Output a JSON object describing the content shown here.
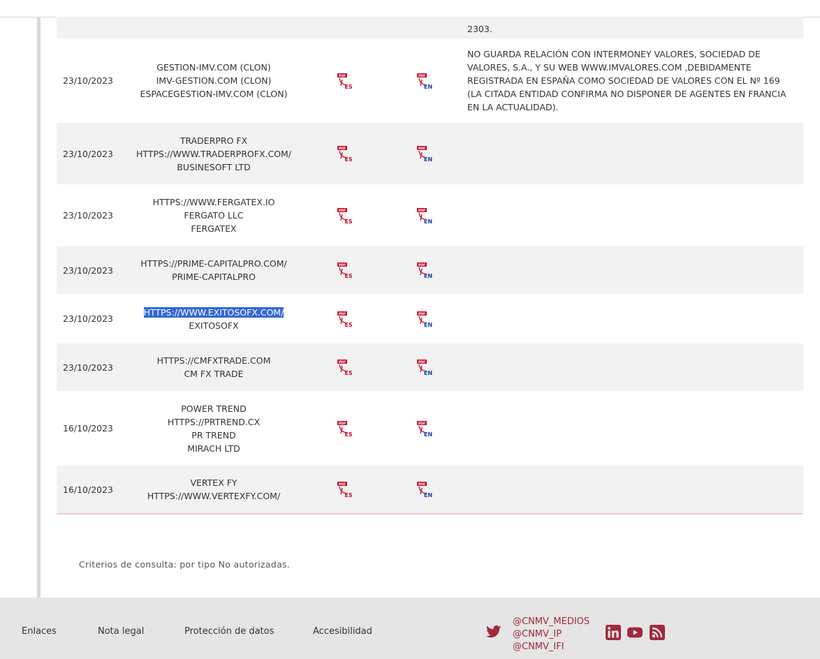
{
  "rows": [
    {
      "date": "",
      "names": [],
      "observations": "2303."
    },
    {
      "date": "23/10/2023",
      "names": [
        "GESTION-IMV.COM (CLON)",
        "IMV-GESTION.COM (CLON)",
        "ESPACEGESTION-IMV.COM (CLON)"
      ],
      "observations": "NO GUARDA RELACIÓN CON INTERMONEY VALORES, SOCIEDAD DE VALORES, S.A., Y SU WEB WWW.IMVALORES.COM ,DEBIDAMENTE REGISTRADA EN ESPAÑA COMO SOCIEDAD DE VALORES CON EL Nº 169 (LA CITADA ENTIDAD CONFIRMA NO DISPONER DE AGENTES EN FRANCIA EN LA ACTUALIDAD)."
    },
    {
      "date": "23/10/2023",
      "names": [
        "TRADERPRO FX",
        "HTTPS://WWW.TRADERPROFX.COM/",
        "BUSINESOFT LTD"
      ],
      "observations": ""
    },
    {
      "date": "23/10/2023",
      "names": [
        "HTTPS://WWW.FERGATEX.IO",
        "FERGATO LLC",
        "FERGATEX"
      ],
      "observations": ""
    },
    {
      "date": "23/10/2023",
      "names": [
        "HTTPS://PRIME-CAPITALPRO.COM/",
        "PRIME-CAPITALPRO"
      ],
      "observations": ""
    },
    {
      "date": "23/10/2023",
      "names": [
        "HTTPS://WWW.EXITOSOFX.COM/",
        "EXITOSOFX"
      ],
      "observations": ""
    },
    {
      "date": "23/10/2023",
      "names": [
        "HTTPS://CMFXTRADE.COM",
        "CM FX TRADE"
      ],
      "observations": ""
    },
    {
      "date": "16/10/2023",
      "names": [
        "POWER TREND",
        "HTTPS://PRTREND.CX",
        "PR TREND",
        "MIRACH LTD"
      ],
      "observations": ""
    },
    {
      "date": "16/10/2023",
      "names": [
        "VERTEX FY",
        "HTTPS://WWW.VERTEXFY.COM/"
      ],
      "observations": ""
    }
  ],
  "pdf_icons": {
    "spanish": "pdf-es-icon",
    "english": "pdf-en-icon",
    "spanish_tag": "ES",
    "english_tag": "EN",
    "pdf_tag": "PDF"
  },
  "selection": {
    "row": 5,
    "line": 0
  },
  "criteria": "Criterios de consulta: por tipo No autorizadas.",
  "footer": {
    "links": [
      "Enlaces",
      "Nota legal",
      "Protección de datos",
      "Accesibilidad"
    ],
    "twitter_handles": [
      "@CNMV_MEDIOS",
      "@CNMV_IP",
      "@CNMV_IFI"
    ],
    "social_icons": [
      "twitter-icon",
      "linkedin-icon",
      "youtube-icon",
      "rss-icon"
    ]
  },
  "colors": {
    "brand": "#a3283f",
    "row_alt": "#f2f2f2",
    "footer_bg": "#e5e5e5",
    "selection": "#3367d6"
  }
}
